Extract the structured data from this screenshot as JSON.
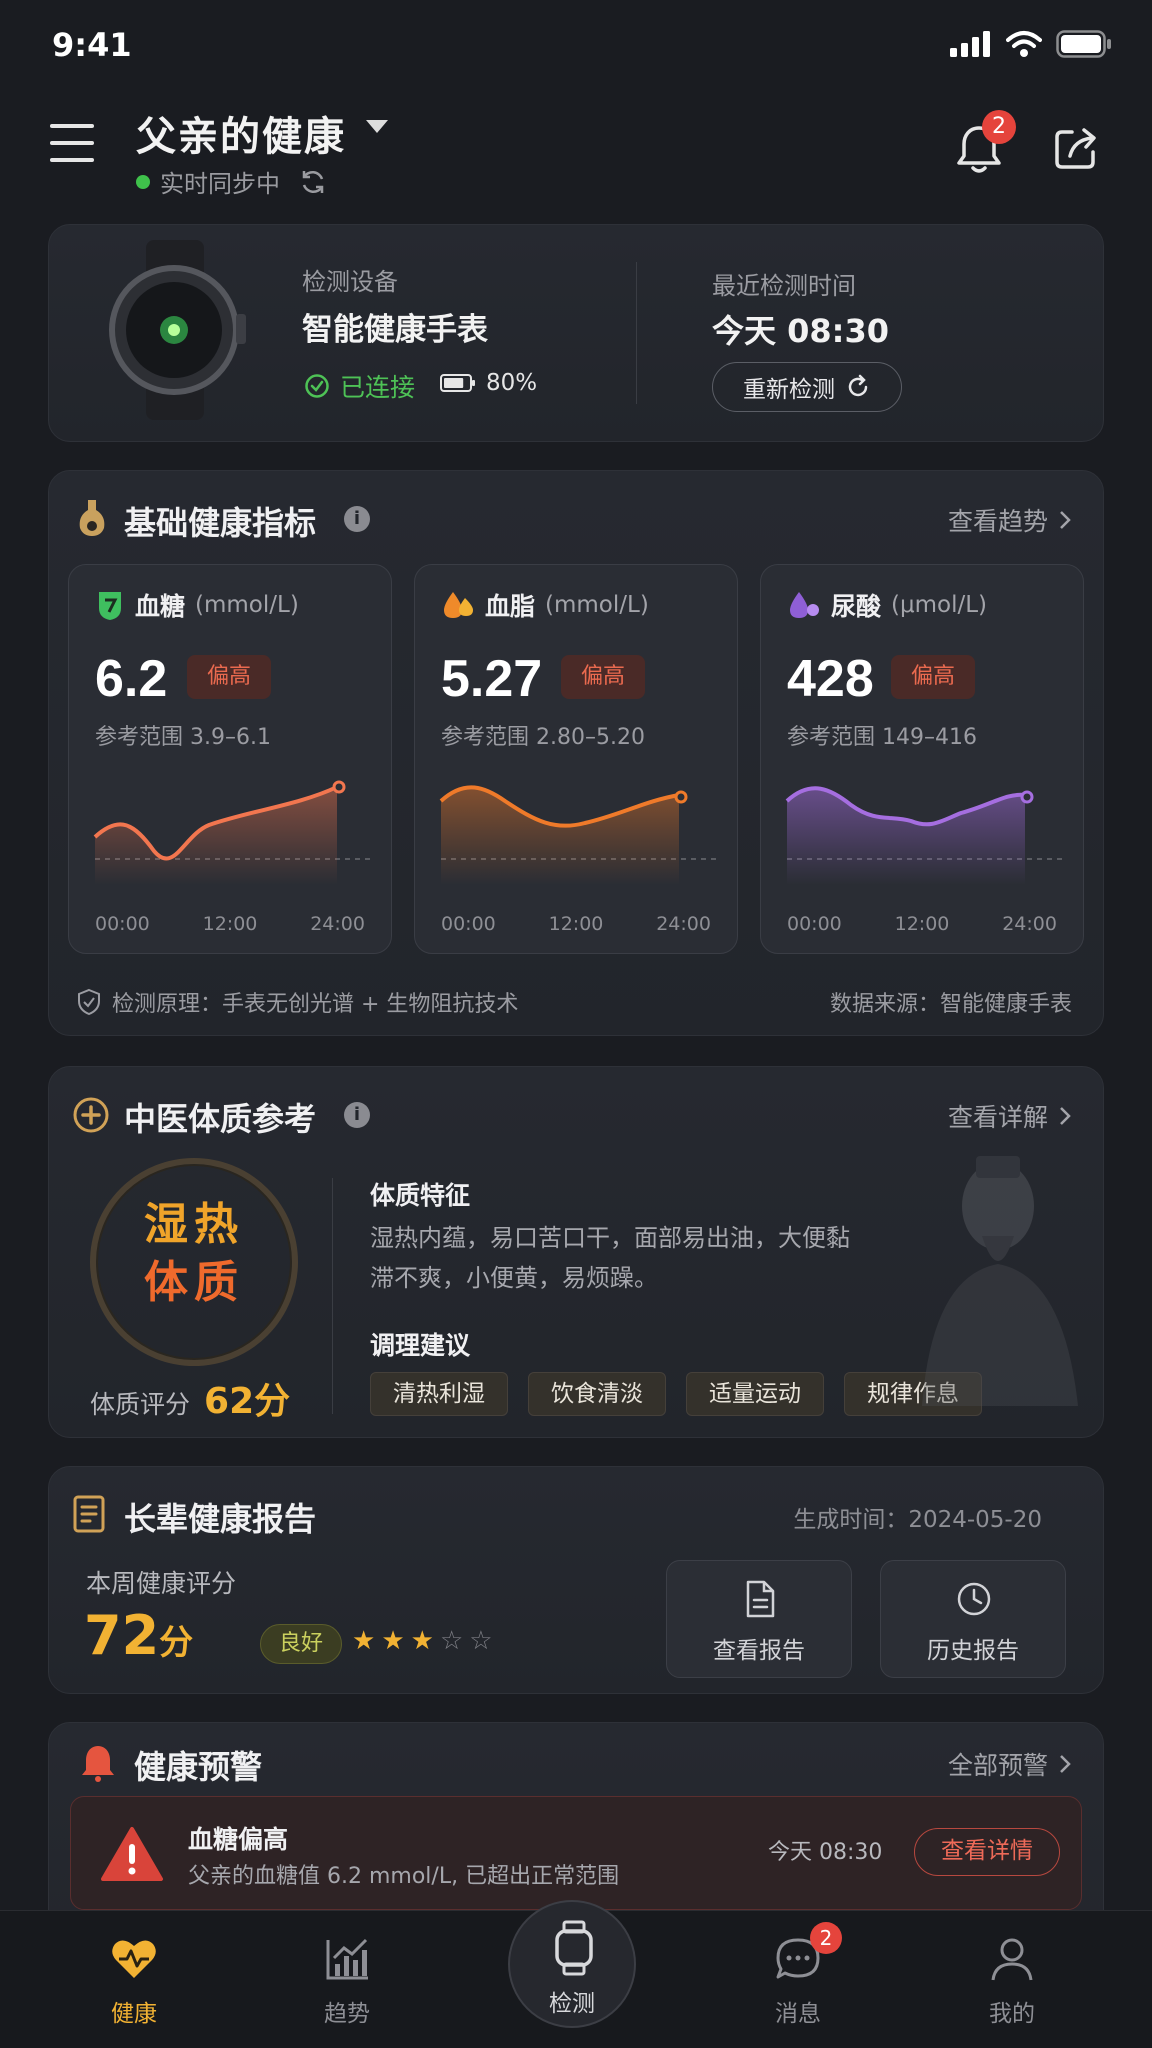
{
  "status_bar": {
    "time": "9:41"
  },
  "header": {
    "title": "父亲的健康",
    "sync_status": "实时同步中",
    "notification_count": "2"
  },
  "device": {
    "label": "检测设备",
    "name": "智能健康手表",
    "connection": "已连接",
    "battery": "80%",
    "battery_level": 0.8,
    "last_check_label": "最近检测时间",
    "last_check_time": "今天 08:30",
    "recheck_label": "重新检测"
  },
  "metrics": {
    "title": "基础健康指标",
    "more_label": "查看趋势",
    "footer_principle": "检测原理：手表无创光谱 + 生物阻抗技术",
    "footer_source": "数据来源：智能健康手表",
    "items": [
      {
        "name": "血糖",
        "unit": "(mmol/L)",
        "value": "6.2",
        "status": "偏高",
        "reference": "参考范围 3.9–6.1",
        "color": "#f2764f",
        "ticks": [
          "00:00",
          "12:00",
          "24:00"
        ]
      },
      {
        "name": "血脂",
        "unit": "(mmol/L)",
        "value": "5.27",
        "status": "偏高",
        "reference": "参考范围 2.80–5.20",
        "color": "#ef7a2a",
        "ticks": [
          "00:00",
          "12:00",
          "24:00"
        ]
      },
      {
        "name": "尿酸",
        "unit": "(μmol/L)",
        "value": "428",
        "status": "偏高",
        "reference": "参考范围 149–416",
        "color": "#a56ee0",
        "ticks": [
          "00:00",
          "12:00",
          "24:00"
        ]
      }
    ]
  },
  "tcm": {
    "title": "中医体质参考",
    "more_label": "查看详解",
    "constitution_line1": "湿热",
    "constitution_line2": "体质",
    "score_label": "体质评分",
    "score_value": "62分",
    "features_title": "体质特征",
    "features_text": "湿热内蕴，易口苦口干，面部易出油，大便黏滞不爽，小便黄，易烦躁。",
    "advice_title": "调理建议",
    "advice_tags": [
      "清热利湿",
      "饮食清淡",
      "适量运动",
      "规律作息"
    ]
  },
  "report": {
    "title": "长辈健康报告",
    "generated": "生成时间：2024-05-20",
    "week_label": "本周健康评分",
    "score_number": "72",
    "score_unit": "分",
    "rating": "良好",
    "stars_filled": 3,
    "stars_total": 5,
    "view_label": "查看报告",
    "history_label": "历史报告"
  },
  "warnings": {
    "title": "健康预警",
    "more_label": "全部预警",
    "items": [
      {
        "title": "血糖偏高",
        "desc": "父亲的血糖值 6.2 mmol/L, 已超出正常范围",
        "time": "今天 08:30",
        "action": "查看详情"
      }
    ]
  },
  "tabbar": {
    "items": [
      {
        "label": "健康",
        "icon": "heart-pulse-icon"
      },
      {
        "label": "趋势",
        "icon": "chart-icon"
      },
      {
        "label": "检测",
        "icon": "watch-icon"
      },
      {
        "label": "消息",
        "icon": "chat-icon",
        "badge": "2"
      },
      {
        "label": "我的",
        "icon": "user-icon"
      }
    ]
  },
  "colors": {
    "accent": "#f2b233",
    "alert": "#e5443c",
    "ok": "#4ec256"
  }
}
